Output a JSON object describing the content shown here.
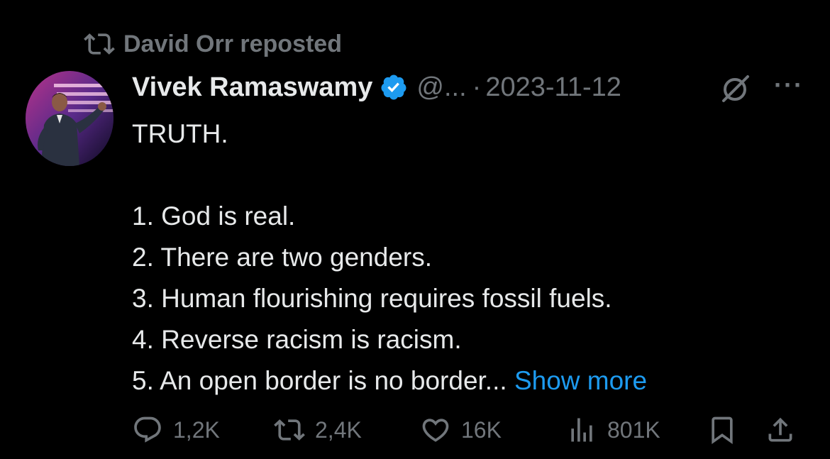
{
  "repost": {
    "icon": "repost-icon",
    "text": "David Orr reposted"
  },
  "post": {
    "author": {
      "display_name": "Vivek Ramaswamy",
      "verified": true,
      "verified_color": "#1d9bf0",
      "handle": "@...",
      "separator": "·",
      "date": "2023-11-12"
    },
    "text": {
      "heading": "TRUTH.",
      "items": [
        "1. God is real.",
        "2. There are two genders.",
        "3. Human flourishing requires fossil fuels.",
        "4. Reverse racism is racism.",
        "5. An open border is no border..."
      ],
      "show_more": "Show more"
    },
    "menu": {
      "grok_icon": "grok-icon",
      "more_label": "···"
    },
    "actions": {
      "replies": "1,2K",
      "reposts": "2,4K",
      "likes": "16K",
      "views": "801K",
      "bookmark_icon": "bookmark-icon",
      "share_icon": "share-icon"
    }
  },
  "colors": {
    "background": "#000000",
    "text": "#e7e9ea",
    "muted": "#71767b",
    "link": "#1d9bf0"
  }
}
